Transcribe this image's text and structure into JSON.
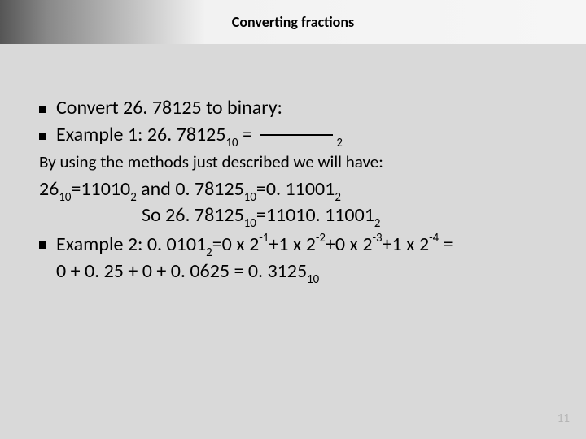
{
  "title": "Converting fractions",
  "bullet1": "Convert 26. 78125 to binary:",
  "ex1_pre": "Example 1: 26. 78125",
  "ex1_base_in": "10",
  "ex1_eq": " = ",
  "ex1_base_out": "2",
  "subtext": "By using the methods just described we will have:",
  "r1_a": "26",
  "r1_a_sub": "10",
  "r1_b": "=11010",
  "r1_b_sub": "2",
  "r1_and": " and 0. 78125",
  "r1_c_sub": "10",
  "r1_c": "=0. 11001",
  "r1_d_sub": "2",
  "so_pre": "So 26. 78125",
  "so_sub1": "10",
  "so_mid": "=11010. 11001",
  "so_sub2": "2",
  "ex2_pre": "Example 2: 0. 0101",
  "ex2_b2": "2",
  "ex2_a": "=0 x 2",
  "p1": "-1",
  "ex2_b": "+1 x 2",
  "p2": "-2",
  "ex2_c": "+0 x 2",
  "p3": "-3",
  "ex2_d": "+1 x 2",
  "p4": "-4",
  "ex2_eq": " = ",
  "ex2_line2_a": "0  + 0. 25 + 0 + 0. 0625 = 0. 3125",
  "ex2_line2_sub": "10",
  "page": "11"
}
